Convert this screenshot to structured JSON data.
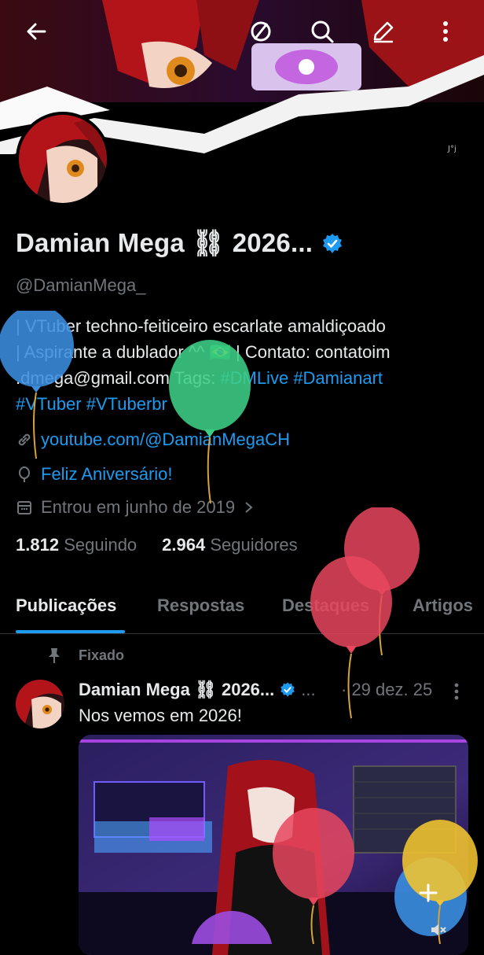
{
  "header": {
    "back_icon": "arrow-left-icon",
    "icons": [
      "block-icon",
      "search-icon",
      "edit-icon",
      "more-vertical-icon"
    ]
  },
  "profile": {
    "name": "Damian Mega ⛓ 2026...",
    "handle": "@DamianMega_",
    "bio": {
      "line1": "| VTuber techno-feiticeiro escarlate amaldiçoado",
      "line2a": "| Aspirante a dublador ^^ ",
      "flag": "🇧🇷",
      "line2b": " | Contato: contatoim",
      "line3a": ".dmega@gmail.com  Tags: ",
      "tag1": "#DMLive",
      "tag2": "#Damianart",
      "tag3": "#VTuber",
      "tag4": "#VTuberbr"
    },
    "link": "youtube.com/@DamianMegaCH",
    "birthday": "Feliz Aniversário!",
    "joined": "Entrou em junho de 2019",
    "following_count": "1.812",
    "following_label": "Seguindo",
    "followers_count": "2.964",
    "followers_label": "Seguidores"
  },
  "tabs": [
    "Publicações",
    "Respostas",
    "Destaques",
    "Artigos"
  ],
  "post": {
    "pinned_label": "Fixado",
    "author": "Damian Mega ⛓ 2026...",
    "dots": "...",
    "date": "· 29 dez. 25",
    "text": "Nos vemos em 2026!"
  },
  "colors": {
    "accent": "#1d9bf0",
    "muted": "#71767b",
    "text": "#e7e9ea",
    "background": "#000000"
  }
}
